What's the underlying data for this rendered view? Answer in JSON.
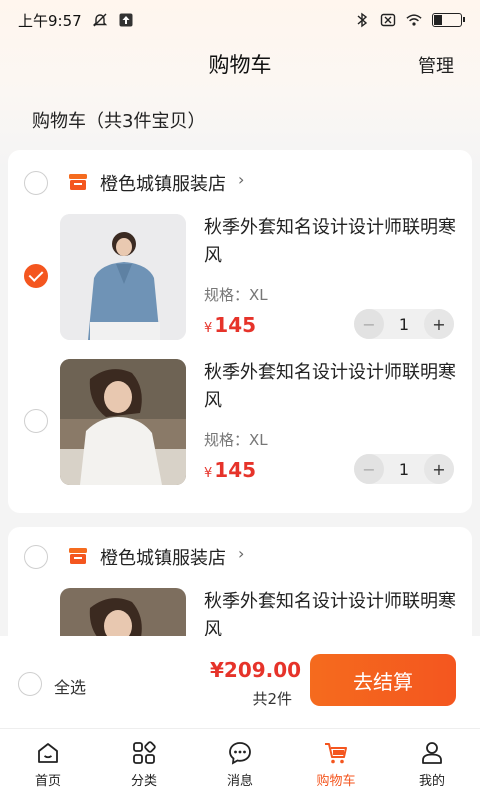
{
  "status_bar": {
    "time": "上午9:57"
  },
  "nav": {
    "title": "购物车",
    "manage_label": "管理"
  },
  "cart": {
    "count_text": "购物车（共3件宝贝）"
  },
  "stores": [
    {
      "name": "橙色城镇服装店",
      "items": [
        {
          "title": "秋季外套知名设计设计师联明寒风",
          "spec": "规格：XL",
          "currency": "¥",
          "price": "145",
          "qty": "1",
          "checked": true
        },
        {
          "title": "秋季外套知名设计设计师联明寒风",
          "spec": "规格：XL",
          "currency": "¥",
          "price": "145",
          "qty": "1",
          "checked": false
        }
      ]
    },
    {
      "name": "橙色城镇服装店",
      "items": [
        {
          "title": "秋季外套知名设计设计师联明寒风"
        }
      ]
    }
  ],
  "checkout": {
    "select_all_label": "全选",
    "total": "¥209.00",
    "count_text": "共2件",
    "button_label": "去结算"
  },
  "tabs": [
    {
      "label": "首页",
      "icon": "home-icon"
    },
    {
      "label": "分类",
      "icon": "category-icon"
    },
    {
      "label": "消息",
      "icon": "message-icon"
    },
    {
      "label": "购物车",
      "icon": "cart-icon",
      "active": true
    },
    {
      "label": "我的",
      "icon": "profile-icon"
    }
  ],
  "colors": {
    "accent": "#f4561f",
    "price": "#e6332a"
  }
}
